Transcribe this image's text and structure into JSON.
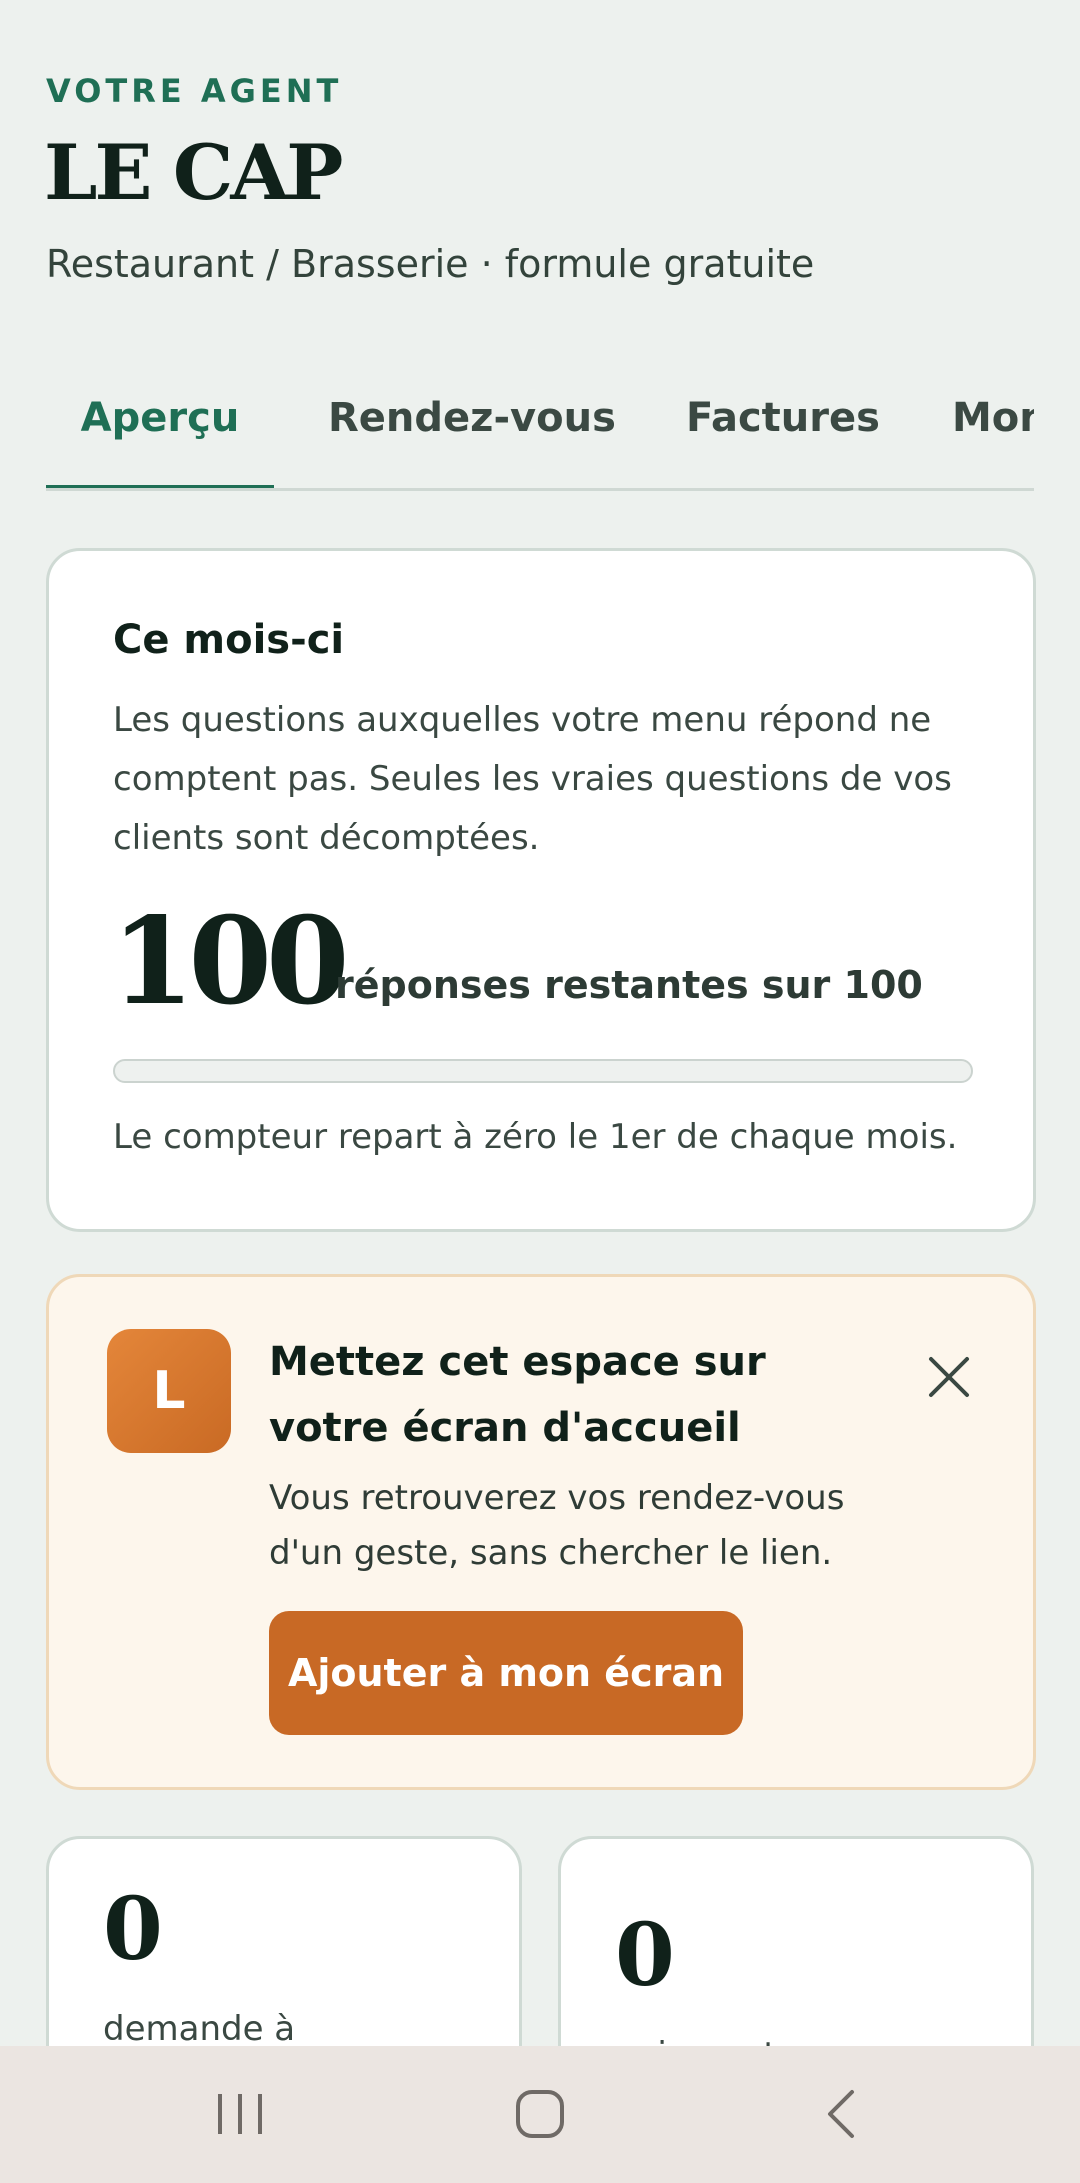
{
  "header": {
    "eyebrow": "VOTRE AGENT",
    "title": "LE CAP",
    "subtitle": "Restaurant / Brasserie · formule gratuite"
  },
  "tabs": [
    {
      "label": "Aperçu",
      "active": true
    },
    {
      "label": "Rendez-vous",
      "active": false
    },
    {
      "label": "Factures",
      "active": false
    },
    {
      "label": "Mon",
      "active": false
    }
  ],
  "usage_card": {
    "heading": "Ce mois-ci",
    "body": "Les questions auxquelles votre menu répond ne comptent pas. Seules les vraies questions de vos clients sont décomptées.",
    "remaining": "100",
    "remaining_label": "réponses restantes sur 100",
    "used_fraction": 0,
    "footnote": "Le compteur repart à zéro le 1er de chaque mois."
  },
  "install_banner": {
    "app_letter": "L",
    "heading": "Mettez cet espace sur votre écran d'accueil",
    "body": "Vous retrouverez vos rendez-vous d'un geste, sans chercher le lien.",
    "button": "Ajouter à mon écran",
    "close_icon": "close-icon"
  },
  "stats": [
    {
      "value": "0",
      "label": "demande à"
    },
    {
      "value": "0",
      "label": "paiement reçu"
    }
  ],
  "system_nav": {
    "recents_icon": "recents-icon",
    "home_icon": "home-icon",
    "back_icon": "back-icon"
  },
  "colors": {
    "accent": "#1f6f55",
    "cta": "#c86925",
    "background": "#edf1ee"
  }
}
